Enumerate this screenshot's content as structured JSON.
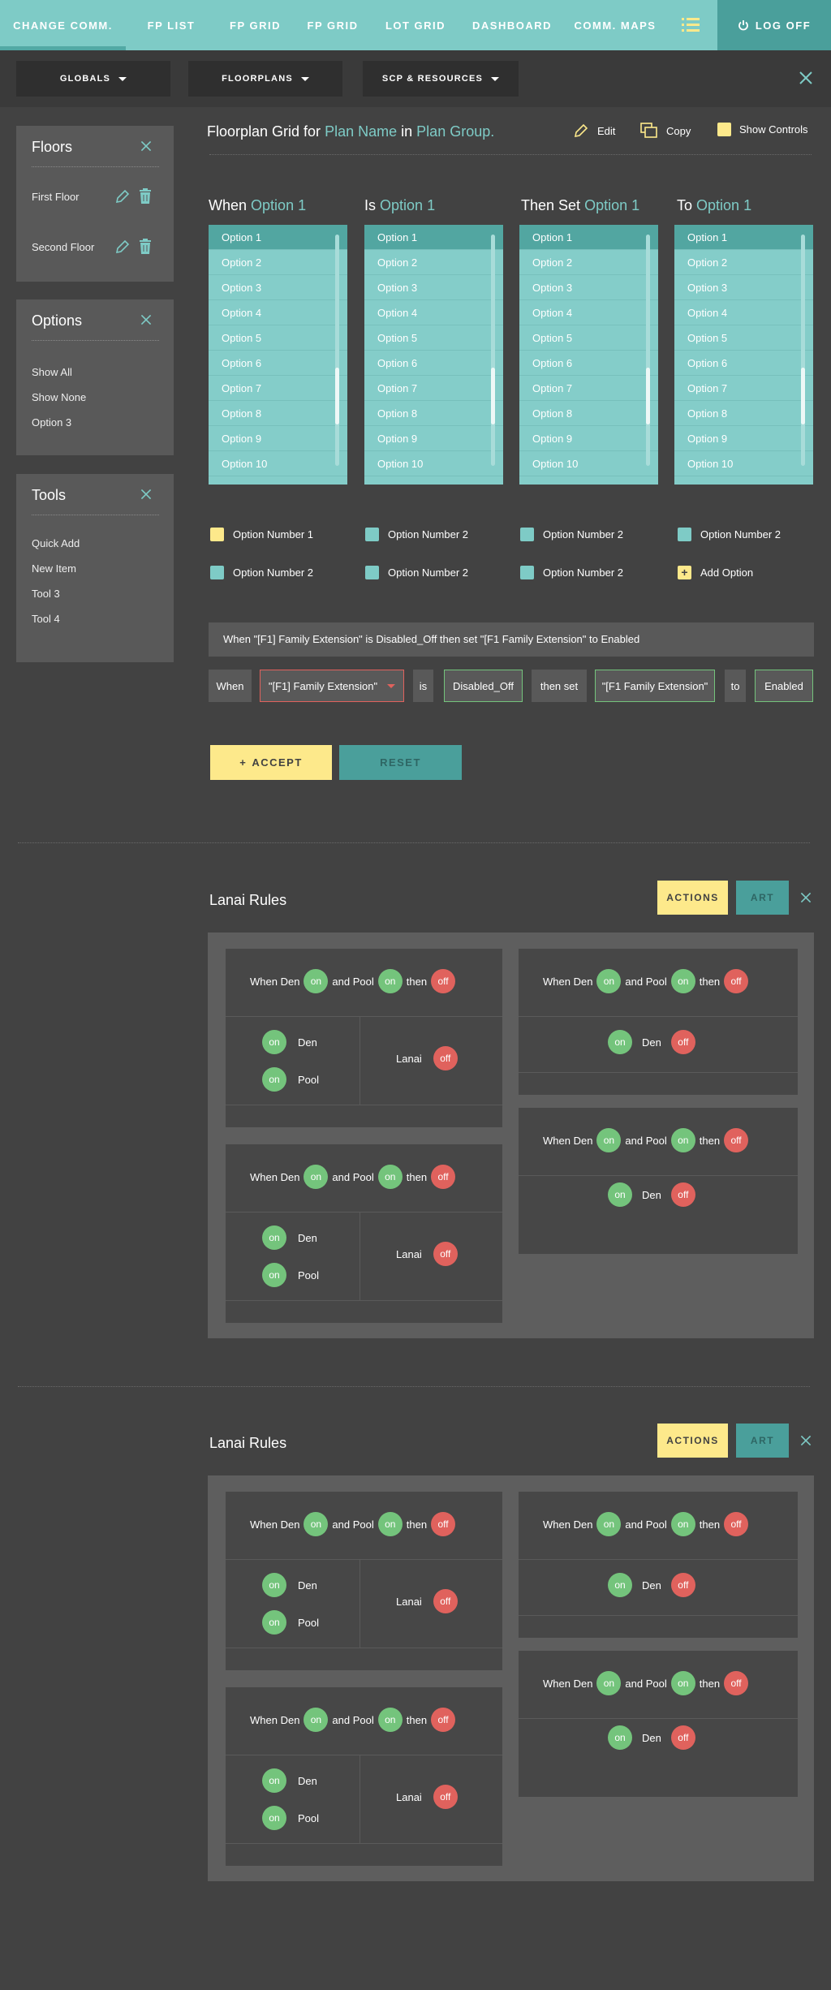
{
  "topnav": {
    "tabs": [
      {
        "label": "CHANGE COMM."
      },
      {
        "label": "FP LIST"
      },
      {
        "label": "FP GRID"
      },
      {
        "label": "FP GRID"
      },
      {
        "label": "LOT GRID"
      },
      {
        "label": "DASHBOARD"
      },
      {
        "label": "COMM. MAPS"
      }
    ],
    "logoff": "LOG OFF"
  },
  "filters": {
    "globals": "GLOBALS",
    "floorplans": "FLOORPLANS",
    "scp": "SCP & RESOURCES"
  },
  "floors": {
    "title": "Floors",
    "items": [
      "First Floor",
      "Second Floor"
    ]
  },
  "options_panel": {
    "title": "Options",
    "items": [
      "Show All",
      "Show None",
      "Option 3"
    ]
  },
  "tools": {
    "title": "Tools",
    "items": [
      "Quick Add",
      "New Item",
      "Tool 3",
      "Tool 4"
    ]
  },
  "header": {
    "prefix": "Floorplan Grid for",
    "plan_name": "Plan Name",
    "in_word": "in",
    "plan_group": "Plan Group.",
    "edit": "Edit",
    "copy": "Copy",
    "show_controls": "Show Controls"
  },
  "columns": [
    {
      "label": "When",
      "value": "Option 1"
    },
    {
      "label": "Is",
      "value": "Option 1"
    },
    {
      "label": "Then Set",
      "value": "Option 1"
    },
    {
      "label": "To",
      "value": "Option 1"
    }
  ],
  "list_options": [
    "Option 1",
    "Option 2",
    "Option 3",
    "Option 4",
    "Option 5",
    "Option 6",
    "Option 7",
    "Option 8",
    "Option 9",
    "Option 10"
  ],
  "checks": {
    "row1": [
      "Option Number 1",
      "Option Number 2",
      "Option Number 2",
      "Option Number 2"
    ],
    "row2": [
      "Option Number 2",
      "Option Number 2",
      "Option Number 2"
    ],
    "add_option": "Add Option"
  },
  "rule": {
    "sentence": "When \"[F1] Family Extension\" is Disabled_Off then set \"[F1 Family Extension\" to Enabled",
    "when": "When",
    "field": "\"[F1] Family Extension\"",
    "is": "is",
    "state": "Disabled_Off",
    "then_set": "then set",
    "target": "\"[F1 Family Extension\"",
    "to": "to",
    "result": "Enabled"
  },
  "buttons": {
    "accept": "ACCEPT",
    "reset": "RESET"
  },
  "lanai": {
    "title": "Lanai Rules",
    "actions": "ACTIONS",
    "art": "ART",
    "when_den": "When Den",
    "and_pool": "and Pool",
    "then": "then",
    "on": "on",
    "off": "off",
    "den": "Den",
    "pool": "Pool",
    "lanai": "Lanai"
  },
  "colors": {
    "teal": "#7ecbc6",
    "teal_dark": "#4a9f9b",
    "yellow": "#fde98b",
    "green": "#74c47c",
    "red": "#e0625d"
  }
}
